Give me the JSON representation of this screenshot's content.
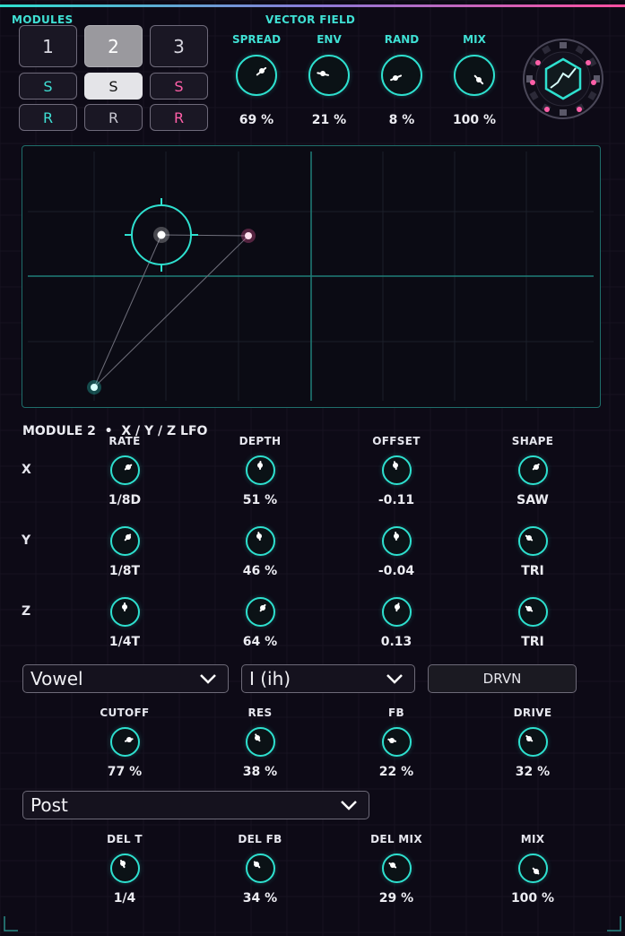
{
  "header": {
    "modules_label": "MODULES",
    "vector_field_label": "VECTOR FIELD"
  },
  "modules": {
    "numbers": [
      "1",
      "2",
      "3"
    ],
    "solo_label": "S",
    "reset_label": "R",
    "selected": 2
  },
  "top_knobs": [
    {
      "label": "SPREAD",
      "value": "69 %",
      "level": 0.69
    },
    {
      "label": "ENV",
      "value": "21 %",
      "level": 0.21
    },
    {
      "label": "RAND",
      "value": "8 %",
      "level": 0.08
    },
    {
      "label": "MIX",
      "value": "100 %",
      "level": 1.0
    }
  ],
  "lfo": {
    "title": "MODULE 2  •  X / Y / Z LFO",
    "columns": [
      "RATE",
      "DEPTH",
      "OFFSET",
      "SHAPE"
    ],
    "rows": [
      {
        "axis": "X",
        "values": [
          "1/8D",
          "51 %",
          "-0.11",
          "SAW"
        ],
        "levels": [
          0.7,
          0.51,
          0.45,
          0.68
        ]
      },
      {
        "axis": "Y",
        "values": [
          "1/8T",
          "46 %",
          "-0.04",
          "TRI"
        ],
        "levels": [
          0.66,
          0.46,
          0.48,
          0.3
        ]
      },
      {
        "axis": "Z",
        "values": [
          "1/4T",
          "64 %",
          "0.13",
          "TRI"
        ],
        "levels": [
          0.5,
          0.64,
          0.56,
          0.3
        ]
      }
    ]
  },
  "filter": {
    "type_value": "Vowel",
    "vowel_value": "I (ih)",
    "drive_button": "DRVN",
    "knobs": [
      {
        "label": "CUTOFF",
        "value": "77 %",
        "level": 0.77
      },
      {
        "label": "RES",
        "value": "38 %",
        "level": 0.38
      },
      {
        "label": "FB",
        "value": "22 %",
        "level": 0.22
      },
      {
        "label": "DRIVE",
        "value": "32 %",
        "level": 0.32
      }
    ]
  },
  "delay": {
    "routing_value": "Post",
    "knobs": [
      {
        "label": "DEL T",
        "value": "1/4",
        "level": 0.4
      },
      {
        "label": "DEL FB",
        "value": "34 %",
        "level": 0.34
      },
      {
        "label": "DEL MIX",
        "value": "29 %",
        "level": 0.29
      },
      {
        "label": "MIX",
        "value": "100 %",
        "level": 1.0
      }
    ]
  },
  "colors": {
    "accent": "#2ee0cf",
    "pink": "#ff5fa8",
    "background": "#0d0a16"
  }
}
